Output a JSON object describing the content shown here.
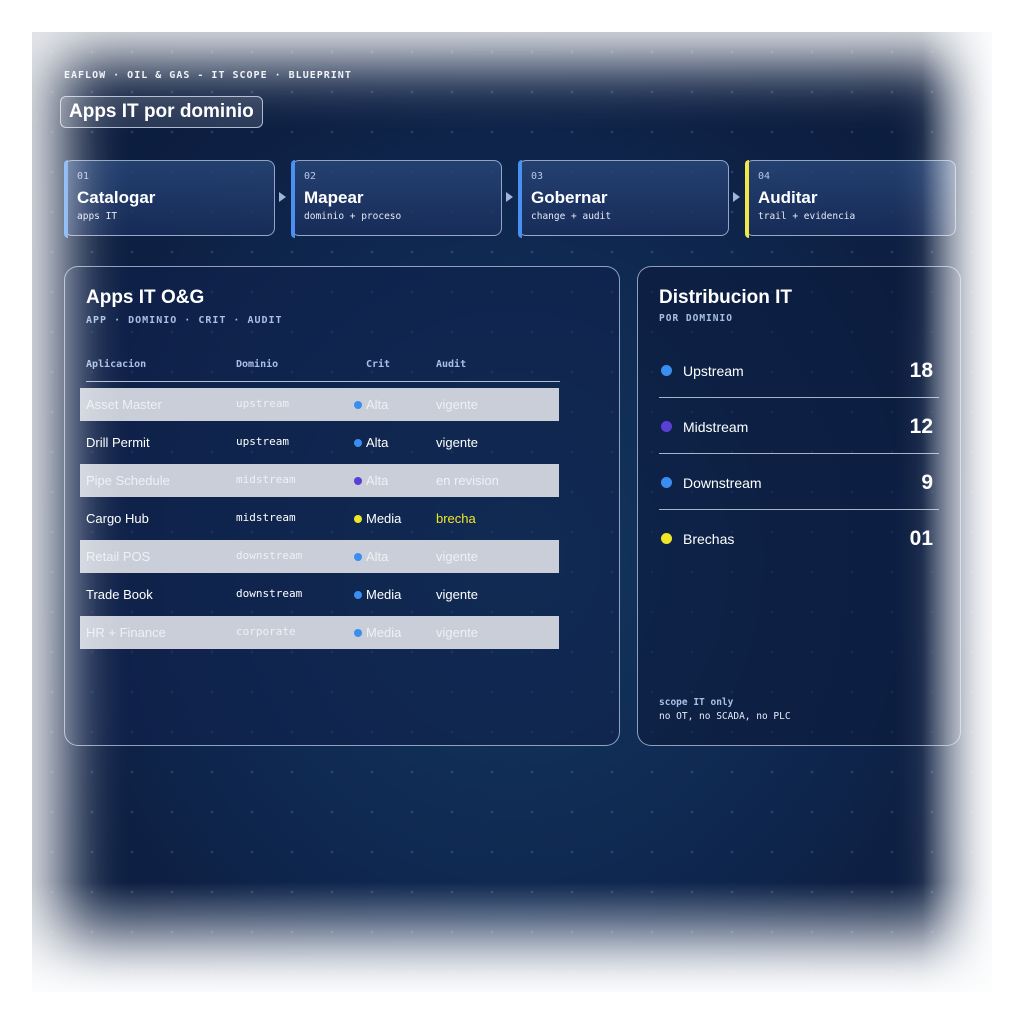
{
  "header": {
    "eyebrow": "EAFLOW · OIL & GAS - IT SCOPE · BLUEPRINT",
    "title": "Apps IT por dominio"
  },
  "steps": [
    {
      "num": "01",
      "name": "Catalogar",
      "sub": "apps IT",
      "color": "#4a90f0"
    },
    {
      "num": "02",
      "name": "Mapear",
      "sub": "dominio + proceso",
      "color": "#4a90f0"
    },
    {
      "num": "03",
      "name": "Gobernar",
      "sub": "change + audit",
      "color": "#4a90f0"
    },
    {
      "num": "04",
      "name": "Auditar",
      "sub": "trail + evidencia",
      "color": "#f1e64a"
    }
  ],
  "apps_panel": {
    "title": "Apps IT O&G",
    "subtitle": "APP · DOMINIO · CRIT · AUDIT",
    "columns": [
      "Aplicacion",
      "Dominio",
      "Crit",
      "Audit"
    ],
    "rows": [
      {
        "app": "Asset Master",
        "domain": "upstream",
        "crit": "Alta",
        "crit_color": "#3a8ef0",
        "audit": "vigente",
        "audit_color": "#eef1f6",
        "light": true
      },
      {
        "app": "Drill Permit",
        "domain": "upstream",
        "crit": "Alta",
        "crit_color": "#3a8ef0",
        "audit": "vigente",
        "audit_color": "#ffffff",
        "light": false
      },
      {
        "app": "Pipe Schedule",
        "domain": "midstream",
        "crit": "Alta",
        "crit_color": "#5a3fd6",
        "audit": "en revision",
        "audit_color": "#eef1f6",
        "light": true
      },
      {
        "app": "Cargo Hub",
        "domain": "midstream",
        "crit": "Media",
        "crit_color": "#f0e629",
        "audit": "brecha",
        "audit_color": "#f0e629",
        "light": false
      },
      {
        "app": "Retail POS",
        "domain": "downstream",
        "crit": "Alta",
        "crit_color": "#3a8ef0",
        "audit": "vigente",
        "audit_color": "#eef1f6",
        "light": true
      },
      {
        "app": "Trade Book",
        "domain": "downstream",
        "crit": "Media",
        "crit_color": "#3a8ef0",
        "audit": "vigente",
        "audit_color": "#ffffff",
        "light": false
      },
      {
        "app": "HR + Finance",
        "domain": "corporate",
        "crit": "Media",
        "crit_color": "#3a8ef0",
        "audit": "vigente",
        "audit_color": "#eef1f6",
        "light": true
      }
    ]
  },
  "dist_panel": {
    "title": "Distribucion IT",
    "subtitle": "POR DOMINIO",
    "items": [
      {
        "label": "Upstream",
        "value": "18",
        "color": "#3a8ef0"
      },
      {
        "label": "Midstream",
        "value": "12",
        "color": "#5a3fd6"
      },
      {
        "label": "Downstream",
        "value": "9",
        "color": "#3a8ef0"
      },
      {
        "label": "Brechas",
        "value": "01",
        "color": "#f0e629"
      }
    ],
    "note_title": "scope IT only",
    "note_body": "no OT, no SCADA, no PLC"
  }
}
